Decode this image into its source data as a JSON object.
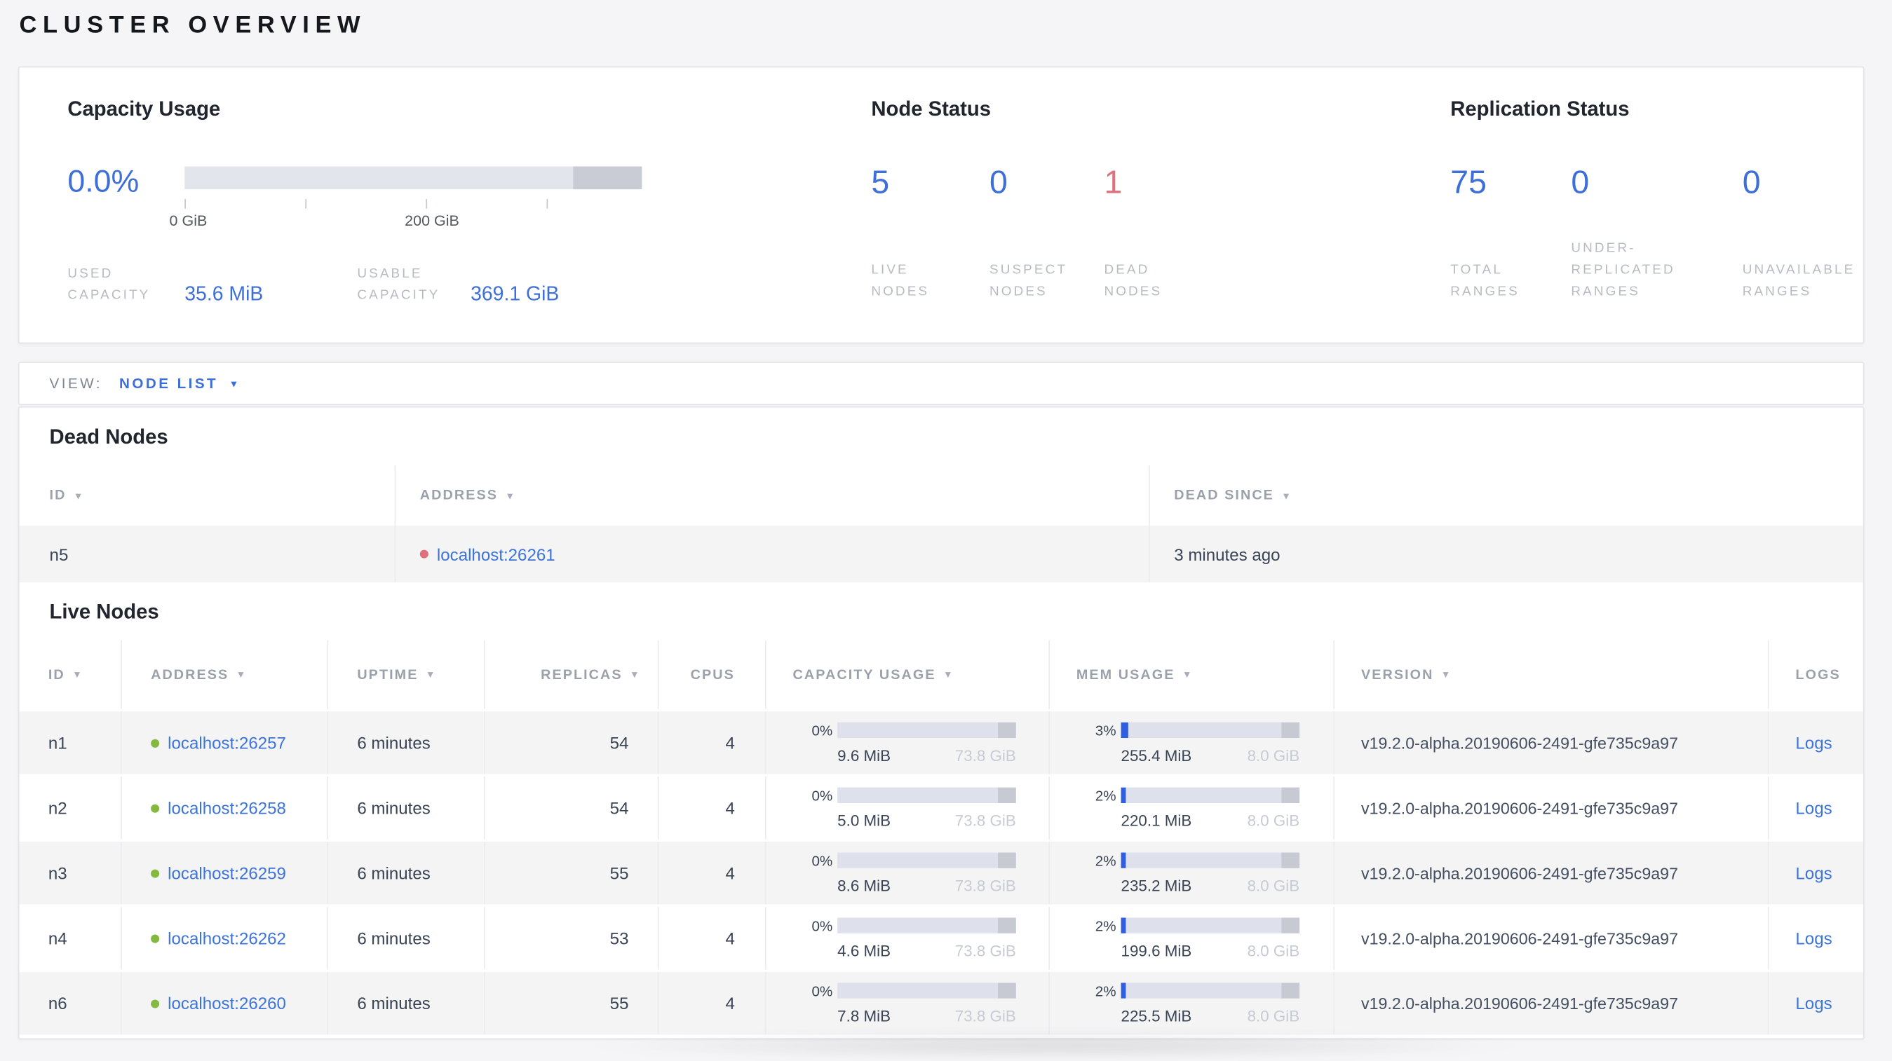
{
  "page_title": "CLUSTER OVERVIEW",
  "colors": {
    "accent_blue": "#3e6fd8",
    "link_blue": "#3d74da",
    "dead_red": "#dd7280",
    "live_green": "#84b940",
    "row_gray": "#f4f4f5"
  },
  "summary": {
    "capacity": {
      "title": "Capacity Usage",
      "percent": "0.0%",
      "tick_label_start": "0 GiB",
      "tick_label_mid": "200 GiB",
      "used": {
        "label": "USED CAPACITY",
        "value": "35.6 MiB"
      },
      "usable": {
        "label": "USABLE CAPACITY",
        "value": "369.1 GiB"
      }
    },
    "node_status": {
      "title": "Node Status",
      "metrics": [
        {
          "value": "5",
          "label": "LIVE NODES"
        },
        {
          "value": "0",
          "label": "SUSPECT NODES"
        },
        {
          "value": "1",
          "label": "DEAD NODES"
        }
      ]
    },
    "replication": {
      "title": "Replication Status",
      "metrics": [
        {
          "value": "75",
          "label": "TOTAL RANGES"
        },
        {
          "value": "0",
          "label": "UNDER-REPLICATED RANGES"
        },
        {
          "value": "0",
          "label": "UNAVAILABLE RANGES"
        }
      ]
    }
  },
  "view_bar": {
    "label": "VIEW:",
    "selected": "NODE LIST"
  },
  "dead_nodes": {
    "title": "Dead Nodes",
    "columns": [
      "ID",
      "ADDRESS",
      "DEAD SINCE"
    ],
    "rows": [
      {
        "id": "n5",
        "address": "localhost:26261",
        "dead_since": "3 minutes ago"
      }
    ]
  },
  "live_nodes": {
    "title": "Live Nodes",
    "columns": [
      "ID",
      "ADDRESS",
      "UPTIME",
      "REPLICAS",
      "CPUS",
      "CAPACITY USAGE",
      "MEM USAGE",
      "VERSION",
      "LOGS"
    ],
    "rows": [
      {
        "id": "n1",
        "address": "localhost:26257",
        "uptime": "6 minutes",
        "replicas": "54",
        "cpus": "4",
        "capacity": {
          "pct": "0%",
          "used": "9.6 MiB",
          "total": "73.8 GiB",
          "fill": 0
        },
        "mem": {
          "pct": "3%",
          "used": "255.4 MiB",
          "total": "8.0 GiB",
          "fill": 3
        },
        "version": "v19.2.0-alpha.20190606-2491-gfe735c9a97",
        "logs_label": "Logs"
      },
      {
        "id": "n2",
        "address": "localhost:26258",
        "uptime": "6 minutes",
        "replicas": "54",
        "cpus": "4",
        "capacity": {
          "pct": "0%",
          "used": "5.0 MiB",
          "total": "73.8 GiB",
          "fill": 0
        },
        "mem": {
          "pct": "2%",
          "used": "220.1 MiB",
          "total": "8.0 GiB",
          "fill": 2
        },
        "version": "v19.2.0-alpha.20190606-2491-gfe735c9a97",
        "logs_label": "Logs"
      },
      {
        "id": "n3",
        "address": "localhost:26259",
        "uptime": "6 minutes",
        "replicas": "55",
        "cpus": "4",
        "capacity": {
          "pct": "0%",
          "used": "8.6 MiB",
          "total": "73.8 GiB",
          "fill": 0
        },
        "mem": {
          "pct": "2%",
          "used": "235.2 MiB",
          "total": "8.0 GiB",
          "fill": 2
        },
        "version": "v19.2.0-alpha.20190606-2491-gfe735c9a97",
        "logs_label": "Logs"
      },
      {
        "id": "n4",
        "address": "localhost:26262",
        "uptime": "6 minutes",
        "replicas": "53",
        "cpus": "4",
        "capacity": {
          "pct": "0%",
          "used": "4.6 MiB",
          "total": "73.8 GiB",
          "fill": 0
        },
        "mem": {
          "pct": "2%",
          "used": "199.6 MiB",
          "total": "8.0 GiB",
          "fill": 2
        },
        "version": "v19.2.0-alpha.20190606-2491-gfe735c9a97",
        "logs_label": "Logs"
      },
      {
        "id": "n6",
        "address": "localhost:26260",
        "uptime": "6 minutes",
        "replicas": "55",
        "cpus": "4",
        "capacity": {
          "pct": "0%",
          "used": "7.8 MiB",
          "total": "73.8 GiB",
          "fill": 0
        },
        "mem": {
          "pct": "2%",
          "used": "225.5 MiB",
          "total": "8.0 GiB",
          "fill": 2
        },
        "version": "v19.2.0-alpha.20190606-2491-gfe735c9a97",
        "logs_label": "Logs"
      }
    ]
  }
}
